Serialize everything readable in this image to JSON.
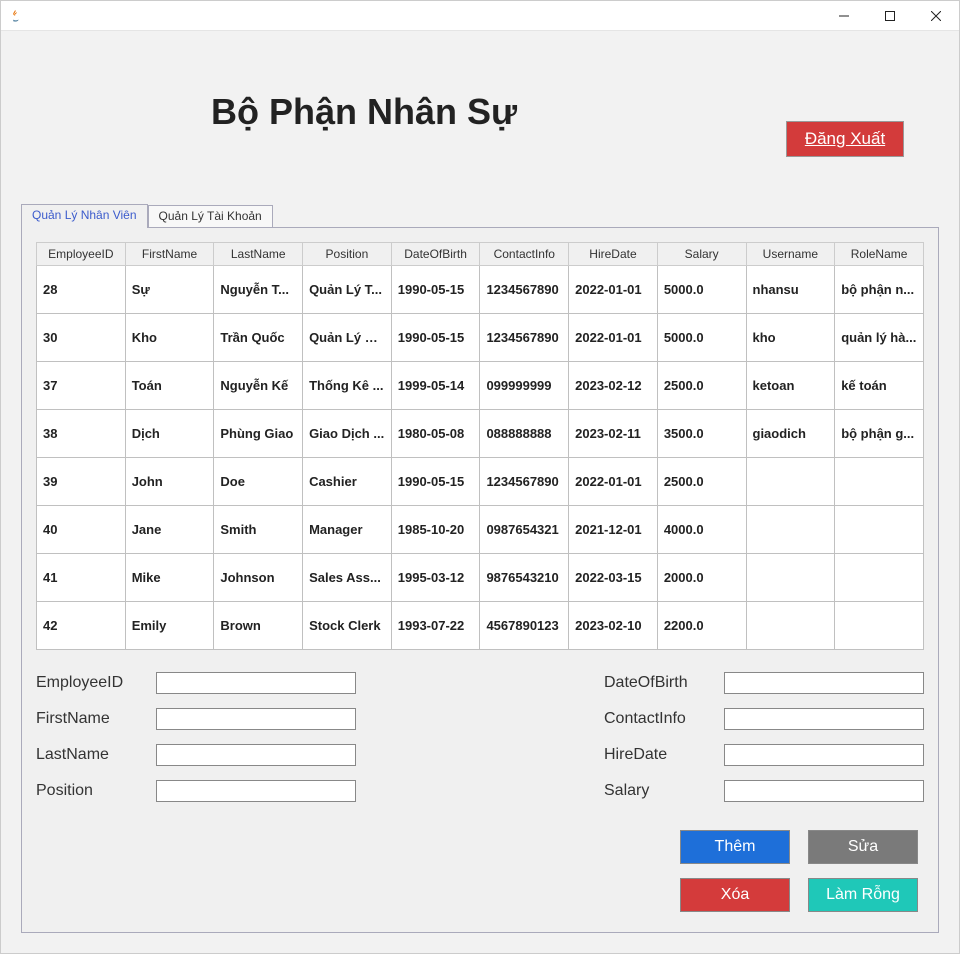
{
  "window": {
    "title": ""
  },
  "header": {
    "page_title": "Bộ Phận Nhân Sự",
    "logout_label": "Đăng Xuất"
  },
  "tabs": [
    {
      "label": "Quản Lý Nhân Viên",
      "active": true
    },
    {
      "label": "Quản Lý Tài Khoản",
      "active": false
    }
  ],
  "table": {
    "columns": [
      "EmployeeID",
      "FirstName",
      "LastName",
      "Position",
      "DateOfBirth",
      "ContactInfo",
      "HireDate",
      "Salary",
      "Username",
      "RoleName"
    ],
    "rows": [
      [
        "28",
        "Sự",
        "Nguyễn T...",
        "Quản Lý T...",
        "1990-05-15",
        "1234567890",
        "2022-01-01",
        "5000.0",
        "nhansu",
        "bộ phận n..."
      ],
      [
        "30",
        "Kho",
        "Trần Quốc",
        "Quản Lý K...",
        "1990-05-15",
        "1234567890",
        "2022-01-01",
        "5000.0",
        "kho",
        "quản lý hà..."
      ],
      [
        "37",
        "Toán",
        "Nguyễn Kế",
        "Thống Kê ...",
        "1999-05-14",
        "099999999",
        "2023-02-12",
        "2500.0",
        "ketoan",
        "kế toán"
      ],
      [
        "38",
        "Dịch",
        "Phùng Giao",
        "Giao Dịch ...",
        "1980-05-08",
        "088888888",
        "2023-02-11",
        "3500.0",
        "giaodich",
        "bộ phận g..."
      ],
      [
        "39",
        "John",
        "Doe",
        "Cashier",
        "1990-05-15",
        "1234567890",
        "2022-01-01",
        "2500.0",
        "",
        ""
      ],
      [
        "40",
        "Jane",
        "Smith",
        "Manager",
        "1985-10-20",
        "0987654321",
        "2021-12-01",
        "4000.0",
        "",
        ""
      ],
      [
        "41",
        "Mike",
        "Johnson",
        "Sales Ass...",
        "1995-03-12",
        "9876543210",
        "2022-03-15",
        "2000.0",
        "",
        ""
      ],
      [
        "42",
        "Emily",
        "Brown",
        "Stock Clerk",
        "1993-07-22",
        "4567890123",
        "2023-02-10",
        "2200.0",
        "",
        ""
      ]
    ]
  },
  "form": {
    "left": [
      {
        "label": "EmployeeID",
        "name": "employeeid",
        "value": ""
      },
      {
        "label": "FirstName",
        "name": "firstname",
        "value": ""
      },
      {
        "label": "LastName",
        "name": "lastname",
        "value": ""
      },
      {
        "label": "Position",
        "name": "position",
        "value": ""
      }
    ],
    "right": [
      {
        "label": "DateOfBirth",
        "name": "dateofbirth",
        "value": ""
      },
      {
        "label": "ContactInfo",
        "name": "contactinfo",
        "value": ""
      },
      {
        "label": "HireDate",
        "name": "hiredate",
        "value": ""
      },
      {
        "label": "Salary",
        "name": "salary",
        "value": ""
      }
    ]
  },
  "actions": {
    "add": "Thêm",
    "edit": "Sửa",
    "del": "Xóa",
    "clear": "Làm Rỗng"
  }
}
